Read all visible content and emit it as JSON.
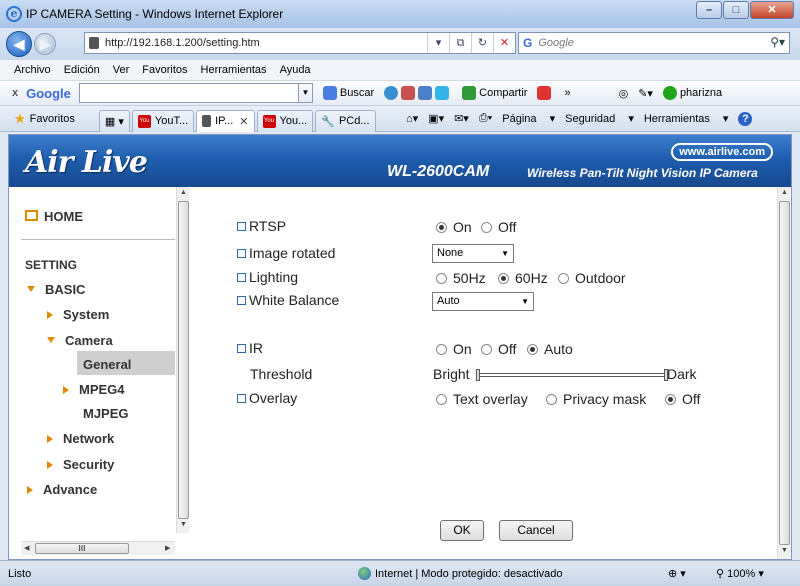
{
  "window": {
    "title": "IP CAMERA Setting - Windows Internet Explorer",
    "minimize": "–",
    "maximize": "□",
    "close": "✕"
  },
  "address": {
    "url": "http://192.168.1.200/setting.htm",
    "search_placeholder": "Google",
    "search_engine": "G"
  },
  "menu": [
    "Archivo",
    "Edición",
    "Ver",
    "Favoritos",
    "Herramientas",
    "Ayuda"
  ],
  "google_bar": {
    "x": "x",
    "logo": "Google",
    "buscar": "Buscar",
    "compartir": "Compartir",
    "user": "pharizna",
    "more": "»"
  },
  "favorites_bar": {
    "label": "Favoritos",
    "tabs": [
      {
        "label": "YouT...",
        "icon": "youtube-icon",
        "close": ""
      },
      {
        "label": "IP...",
        "icon": "page-icon",
        "close": "✕"
      },
      {
        "label": "You...",
        "icon": "youtube-icon",
        "close": ""
      },
      {
        "label": "PCd...",
        "icon": "wrench-icon",
        "close": ""
      }
    ],
    "commands": [
      "Página",
      "Seguridad",
      "Herramientas"
    ],
    "help": "?"
  },
  "banner": {
    "logo": "Air Live",
    "url": "www.airlive.com",
    "model": "WL-2600CAM",
    "description": "Wireless Pan-Tilt Night Vision IP Camera"
  },
  "sidebar": {
    "home": "HOME",
    "setting": "SETTING",
    "basic": "BASIC",
    "system": "System",
    "camera": "Camera",
    "general": "General",
    "mpeg4": "MPEG4",
    "mjpeg": "MJPEG",
    "network": "Network",
    "security": "Security",
    "advance": "Advance",
    "hscroll_grip": "III"
  },
  "form": {
    "rtsp": {
      "label": "RTSP",
      "options": [
        "On",
        "Off"
      ],
      "selected": "On"
    },
    "image_rotated": {
      "label": "Image rotated",
      "value": "None"
    },
    "lighting": {
      "label": "Lighting",
      "options": [
        "50Hz",
        "60Hz",
        "Outdoor"
      ],
      "selected": "60Hz"
    },
    "white_balance": {
      "label": "White Balance",
      "value": "Auto"
    },
    "ir": {
      "label": "IR",
      "options": [
        "On",
        "Off",
        "Auto"
      ],
      "selected": "Auto"
    },
    "threshold": {
      "label": "Threshold",
      "min_label": "Bright",
      "max_label": "Dark"
    },
    "overlay": {
      "label": "Overlay",
      "options": [
        "Text overlay",
        "Privacy mask",
        "Off"
      ],
      "selected": "Off"
    },
    "ok": "OK",
    "cancel": "Cancel"
  },
  "status": {
    "text": "Listo",
    "zone": "Internet | Modo protegido: desactivado",
    "zoom": "100%"
  }
}
